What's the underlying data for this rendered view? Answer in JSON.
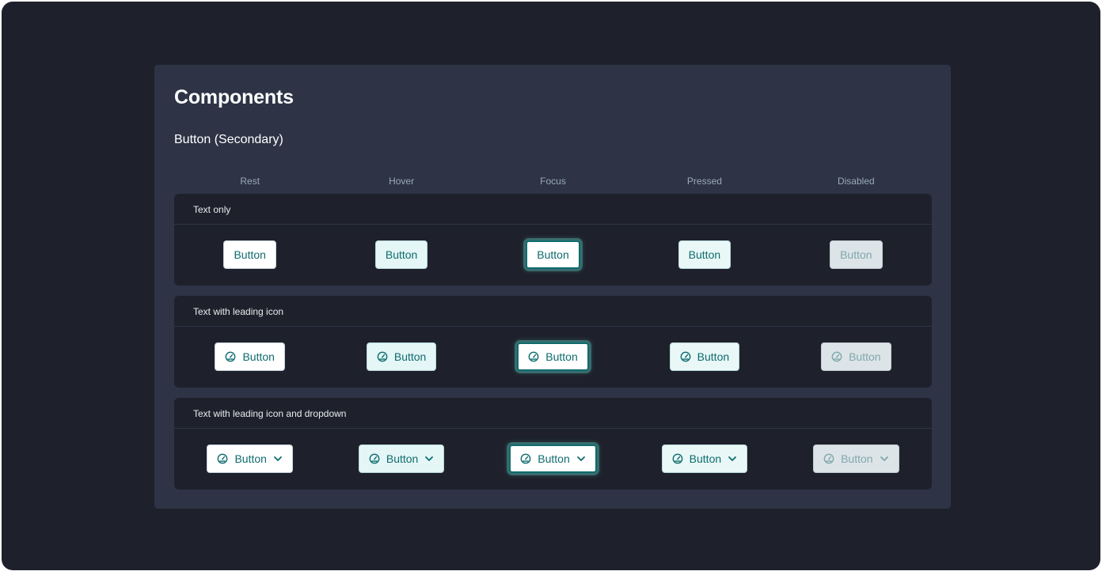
{
  "page": {
    "title": "Components",
    "subtitle": "Button (Secondary)"
  },
  "columns": [
    "Rest",
    "Hover",
    "Focus",
    "Pressed",
    "Disabled"
  ],
  "sections": [
    {
      "title": "Text only",
      "buttons": [
        {
          "label": "Button",
          "state": "rest"
        },
        {
          "label": "Button",
          "state": "hover"
        },
        {
          "label": "Button",
          "state": "focus"
        },
        {
          "label": "Button",
          "state": "pressed"
        },
        {
          "label": "Button",
          "state": "disabled"
        }
      ]
    },
    {
      "title": "Text with leading icon",
      "buttons": [
        {
          "label": "Button",
          "state": "rest",
          "icon": "dashboard-gauge-icon"
        },
        {
          "label": "Button",
          "state": "hover",
          "icon": "dashboard-gauge-icon"
        },
        {
          "label": "Button",
          "state": "focus",
          "icon": "dashboard-gauge-icon"
        },
        {
          "label": "Button",
          "state": "pressed",
          "icon": "dashboard-gauge-icon"
        },
        {
          "label": "Button",
          "state": "disabled",
          "icon": "dashboard-gauge-icon"
        }
      ]
    },
    {
      "title": "Text with leading icon and dropdown",
      "buttons": [
        {
          "label": "Button",
          "state": "rest",
          "icon": "dashboard-gauge-icon",
          "trailing_icon": "chevron-down-icon"
        },
        {
          "label": "Button",
          "state": "hover",
          "icon": "dashboard-gauge-icon",
          "trailing_icon": "chevron-down-icon"
        },
        {
          "label": "Button",
          "state": "focus",
          "icon": "dashboard-gauge-icon",
          "trailing_icon": "chevron-down-icon"
        },
        {
          "label": "Button",
          "state": "pressed",
          "icon": "dashboard-gauge-icon",
          "trailing_icon": "chevron-down-icon"
        },
        {
          "label": "Button",
          "state": "disabled",
          "icon": "dashboard-gauge-icon",
          "trailing_icon": "chevron-down-icon"
        }
      ]
    }
  ],
  "colors": {
    "frame_bg": "#1e212b",
    "card_bg": "#2e3446",
    "section_bg": "#1e212b",
    "accent_teal": "#0f6b6e",
    "hover_bg": "#e4f6f6",
    "disabled_bg": "#dde4e8"
  }
}
